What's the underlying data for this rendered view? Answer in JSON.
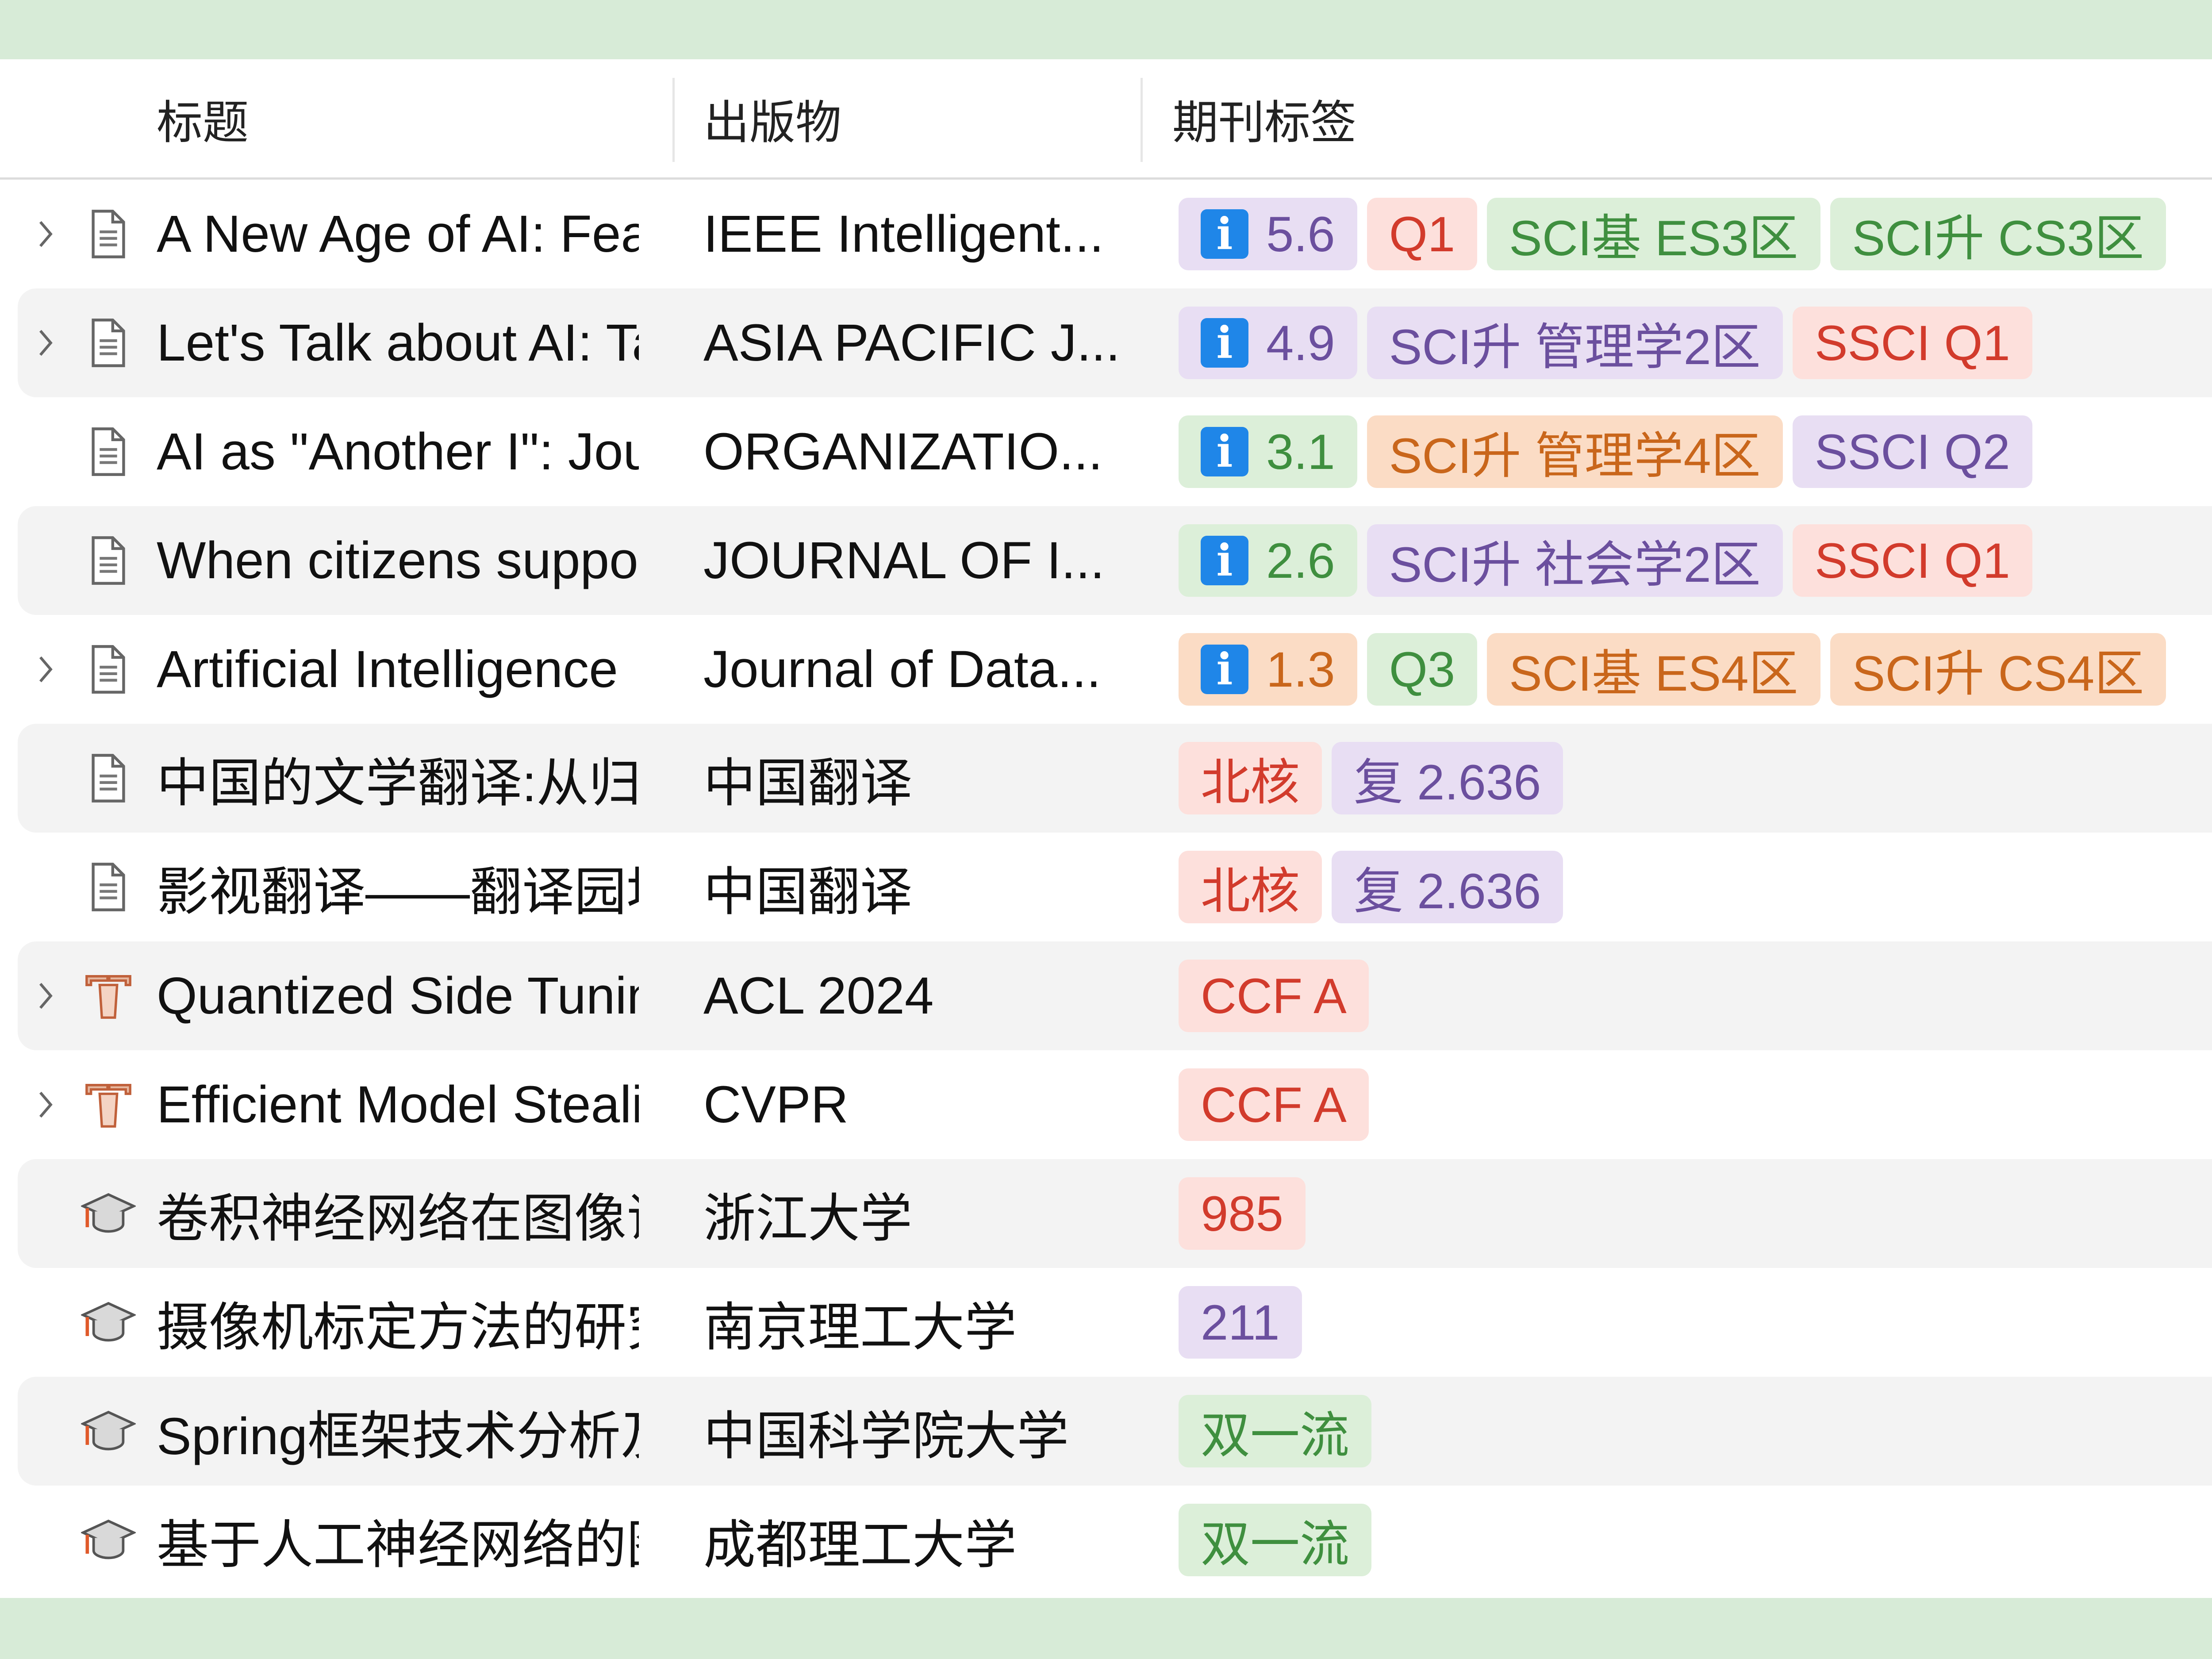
{
  "colors": {
    "band": "#d7ebd7",
    "purple_bg": "#e8def3",
    "purple_fg": "#6b4f9e",
    "red_bg": "#fde0dc",
    "red_fg": "#d23b2c",
    "green_bg": "#dcefd9",
    "green_fg": "#3f8f3f",
    "orange_bg": "#fbdcc5",
    "orange_fg": "#c9661b",
    "info_icon": "#1f86e8"
  },
  "columns": {
    "title": "标题",
    "publication": "出版物",
    "tags": "期刊标签"
  },
  "rows": [
    {
      "expandable": true,
      "item_type": "document-icon",
      "title": "A New Age of AI: Features and Futures",
      "publication": "IEEE Intelligent...",
      "tags": [
        {
          "text": "5.6",
          "info": true,
          "color": "purple"
        },
        {
          "text": "Q1",
          "color": "red"
        },
        {
          "text": "SCI基 ES3区",
          "color": "green"
        },
        {
          "text": "SCI升 CS3区",
          "color": "green"
        }
      ]
    },
    {
      "expandable": true,
      "item_type": "document-icon",
      "title": "Let's Talk about AI: Talking about AI is Not Talking about AI",
      "publication": "ASIA PACIFIC J...",
      "tags": [
        {
          "text": "4.9",
          "info": true,
          "color": "purple"
        },
        {
          "text": "SCI升 管理学2区",
          "color": "purple"
        },
        {
          "text": "SSCI Q1",
          "color": "red"
        }
      ]
    },
    {
      "expandable": false,
      "item_type": "document-icon",
      "title": "AI as \"Another I\": Journey Map of Working with Artificial Intelligence",
      "publication": "ORGANIZATIO...",
      "tags": [
        {
          "text": "3.1",
          "info": true,
          "color": "green"
        },
        {
          "text": "SCI升 管理学4区",
          "color": "orange"
        },
        {
          "text": "SSCI Q2",
          "color": "purple"
        }
      ]
    },
    {
      "expandable": false,
      "item_type": "document-icon",
      "title": "When citizens support AI policies",
      "publication": "JOURNAL OF I...",
      "tags": [
        {
          "text": "2.6",
          "info": true,
          "color": "green"
        },
        {
          "text": "SCI升 社会学2区",
          "color": "purple"
        },
        {
          "text": "SSCI Q1",
          "color": "red"
        }
      ]
    },
    {
      "expandable": true,
      "item_type": "document-icon",
      "title": "Artificial Intelligence",
      "publication": "Journal of Data...",
      "tags": [
        {
          "text": "1.3",
          "info": true,
          "color": "orange"
        },
        {
          "text": "Q3",
          "color": "green"
        },
        {
          "text": "SCI基 ES4区",
          "color": "orange"
        },
        {
          "text": "SCI升 CS4区",
          "color": "orange"
        }
      ]
    },
    {
      "expandable": false,
      "item_type": "document-icon",
      "title": "中国的文学翻译:从归化趋向异化",
      "publication": "中国翻译",
      "tags": [
        {
          "text": "北核",
          "color": "red"
        },
        {
          "text": "复 2.636",
          "color": "purple"
        }
      ]
    },
    {
      "expandable": false,
      "item_type": "document-icon",
      "title": "影视翻译——翻译园地中愈来愈重要的领域",
      "publication": "中国翻译",
      "tags": [
        {
          "text": "北核",
          "color": "red"
        },
        {
          "text": "复 2.636",
          "color": "purple"
        }
      ]
    },
    {
      "expandable": true,
      "item_type": "conference-paper-icon",
      "title": "Quantized Side Tuning",
      "publication": "ACL 2024",
      "tags": [
        {
          "text": "CCF A",
          "color": "red"
        }
      ]
    },
    {
      "expandable": true,
      "item_type": "conference-paper-icon",
      "title": "Efficient Model Stealing",
      "publication": "CVPR",
      "tags": [
        {
          "text": "CCF A",
          "color": "red"
        }
      ]
    },
    {
      "expandable": false,
      "item_type": "thesis-icon",
      "title": "卷积神经网络在图像识别上的应用",
      "publication": "浙江大学",
      "tags": [
        {
          "text": "985",
          "color": "red"
        }
      ]
    },
    {
      "expandable": false,
      "item_type": "thesis-icon",
      "title": "摄像机标定方法的研究",
      "publication": "南京理工大学",
      "tags": [
        {
          "text": "211",
          "color": "purple"
        }
      ]
    },
    {
      "expandable": false,
      "item_type": "thesis-icon",
      "title": "Spring框架技术分析及应用",
      "publication": "中国科学院大学",
      "tags": [
        {
          "text": "双一流",
          "color": "green"
        }
      ]
    },
    {
      "expandable": false,
      "item_type": "thesis-icon",
      "title": "基于人工神经网络的图像识别",
      "publication": "成都理工大学",
      "tags": [
        {
          "text": "双一流",
          "color": "green"
        }
      ]
    }
  ]
}
